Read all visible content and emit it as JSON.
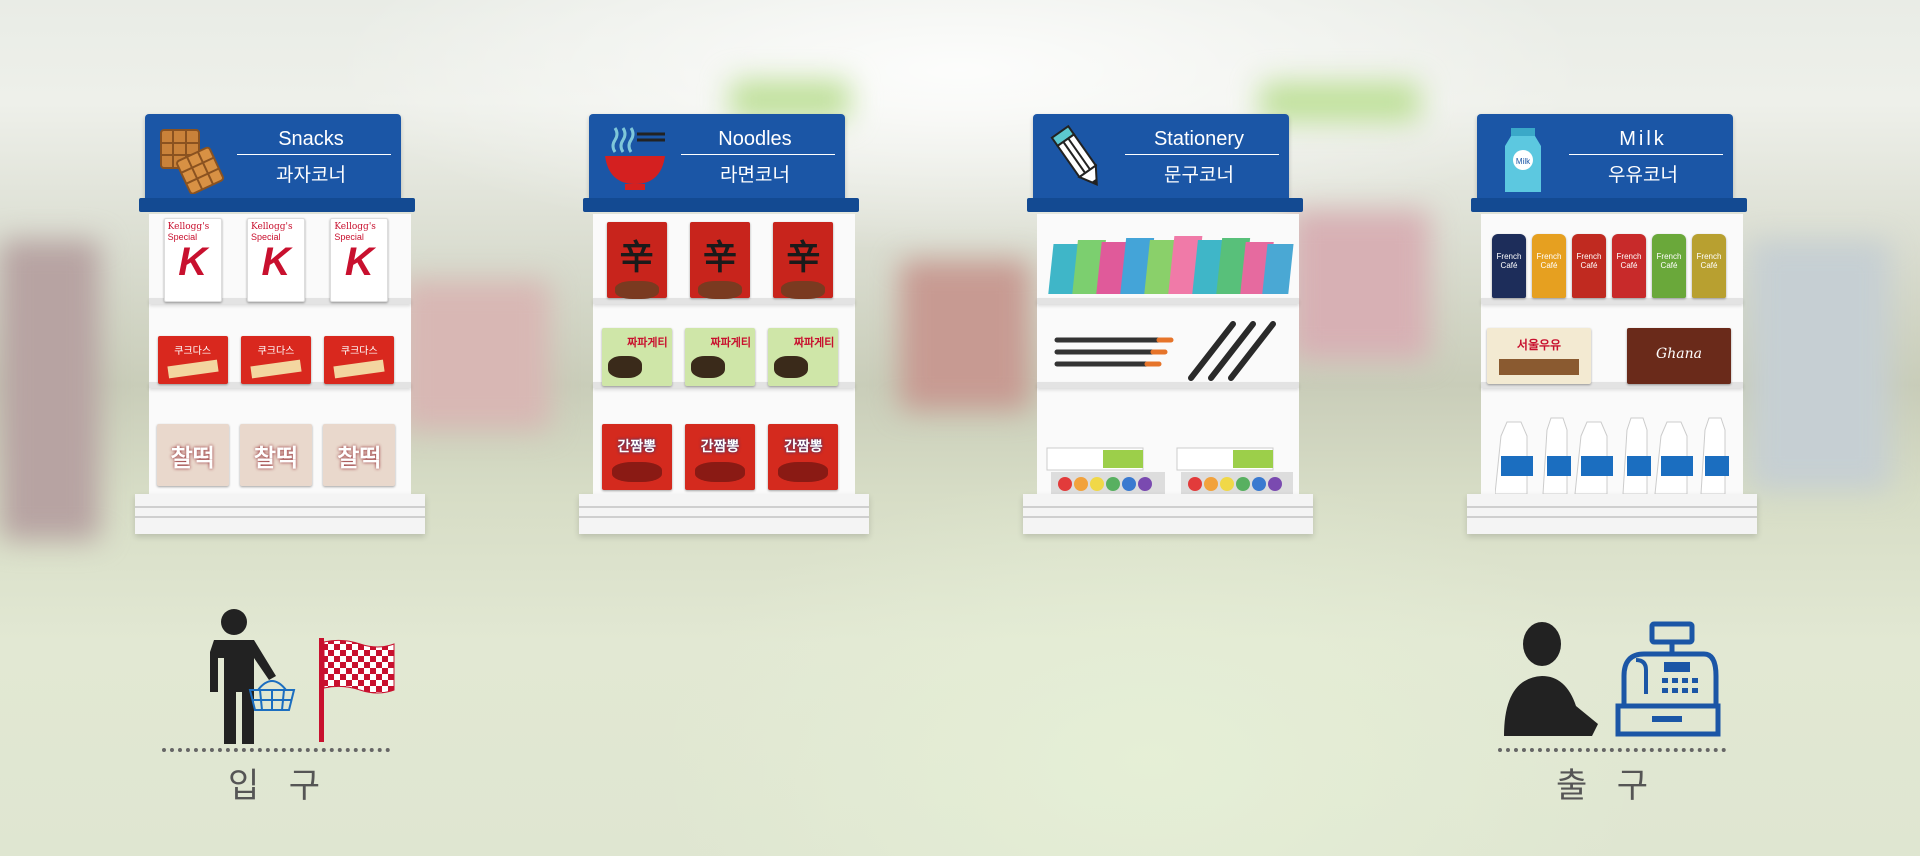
{
  "aisles": [
    {
      "en": "Snacks",
      "ko": "과자코너",
      "icon": "waffle-icon"
    },
    {
      "en": "Noodles",
      "ko": "라면코너",
      "icon": "noodle-bowl-icon"
    },
    {
      "en": "Stationery",
      "ko": "문구코너",
      "icon": "pencil-icon"
    },
    {
      "en": "Milk",
      "ko": "우유코너",
      "icon": "milk-carton-icon"
    }
  ],
  "entrance": {
    "label": "입 구",
    "icons": [
      "shopper-icon",
      "checkered-flag-icon"
    ]
  },
  "exit": {
    "label": "출 구",
    "icons": [
      "cashier-icon",
      "cash-register-icon"
    ]
  },
  "product_text": {
    "cereal_brand": "Kellogg's",
    "cereal_name": "Special",
    "cereal_k": "K",
    "cracker": "쿠크다스",
    "chocopie": "찰떡",
    "ramen": "辛",
    "jjapa": "짜파게티",
    "jjamppong": "간짬뽕",
    "coffee": "French Café",
    "milk1": "서울우유",
    "choco": "Ghana",
    "carton_milk": "Milk"
  },
  "colors": {
    "sign": "#1b56a6",
    "flag": "#c8102e",
    "register": "#1b56a6"
  }
}
